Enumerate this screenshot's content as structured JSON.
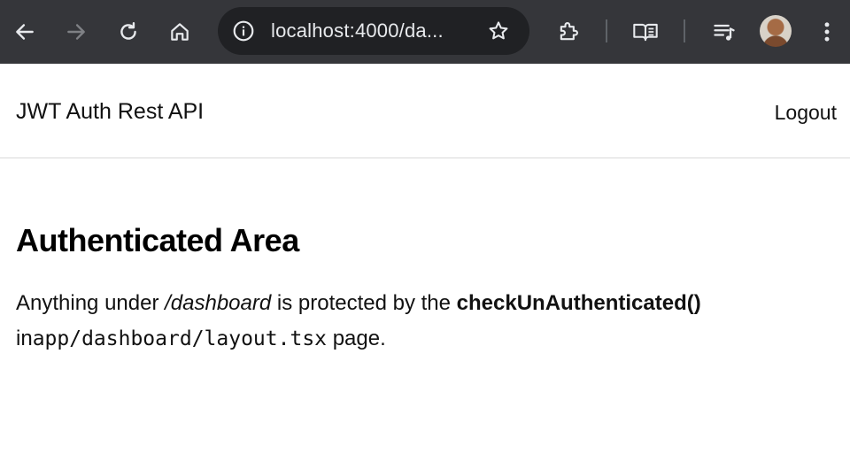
{
  "browser": {
    "url": "localhost:4000/da...",
    "icons": {
      "back": "arrow-left-icon",
      "forward": "arrow-right-icon",
      "reload": "reload-icon",
      "home": "home-icon",
      "site_info": "info-icon",
      "bookmark": "star-icon",
      "extensions": "puzzle-icon",
      "reading_mode": "book-icon",
      "media": "playlist-icon",
      "menu": "kebab-menu-icon"
    },
    "colors": {
      "toolbar": "#35363a",
      "omnibox": "#202124"
    }
  },
  "navbar": {
    "brand": "JWT Auth Rest API",
    "logout": "Logout"
  },
  "main": {
    "heading": "Authenticated Area",
    "p_prefix": "Anything under ",
    "p_path": "/dashboard",
    "p_middle": " is protected by the ",
    "p_function": "checkUnAuthenticated()",
    "p_in": "in",
    "p_file": "app/dashboard/layout.tsx",
    "p_suffix": " page."
  }
}
